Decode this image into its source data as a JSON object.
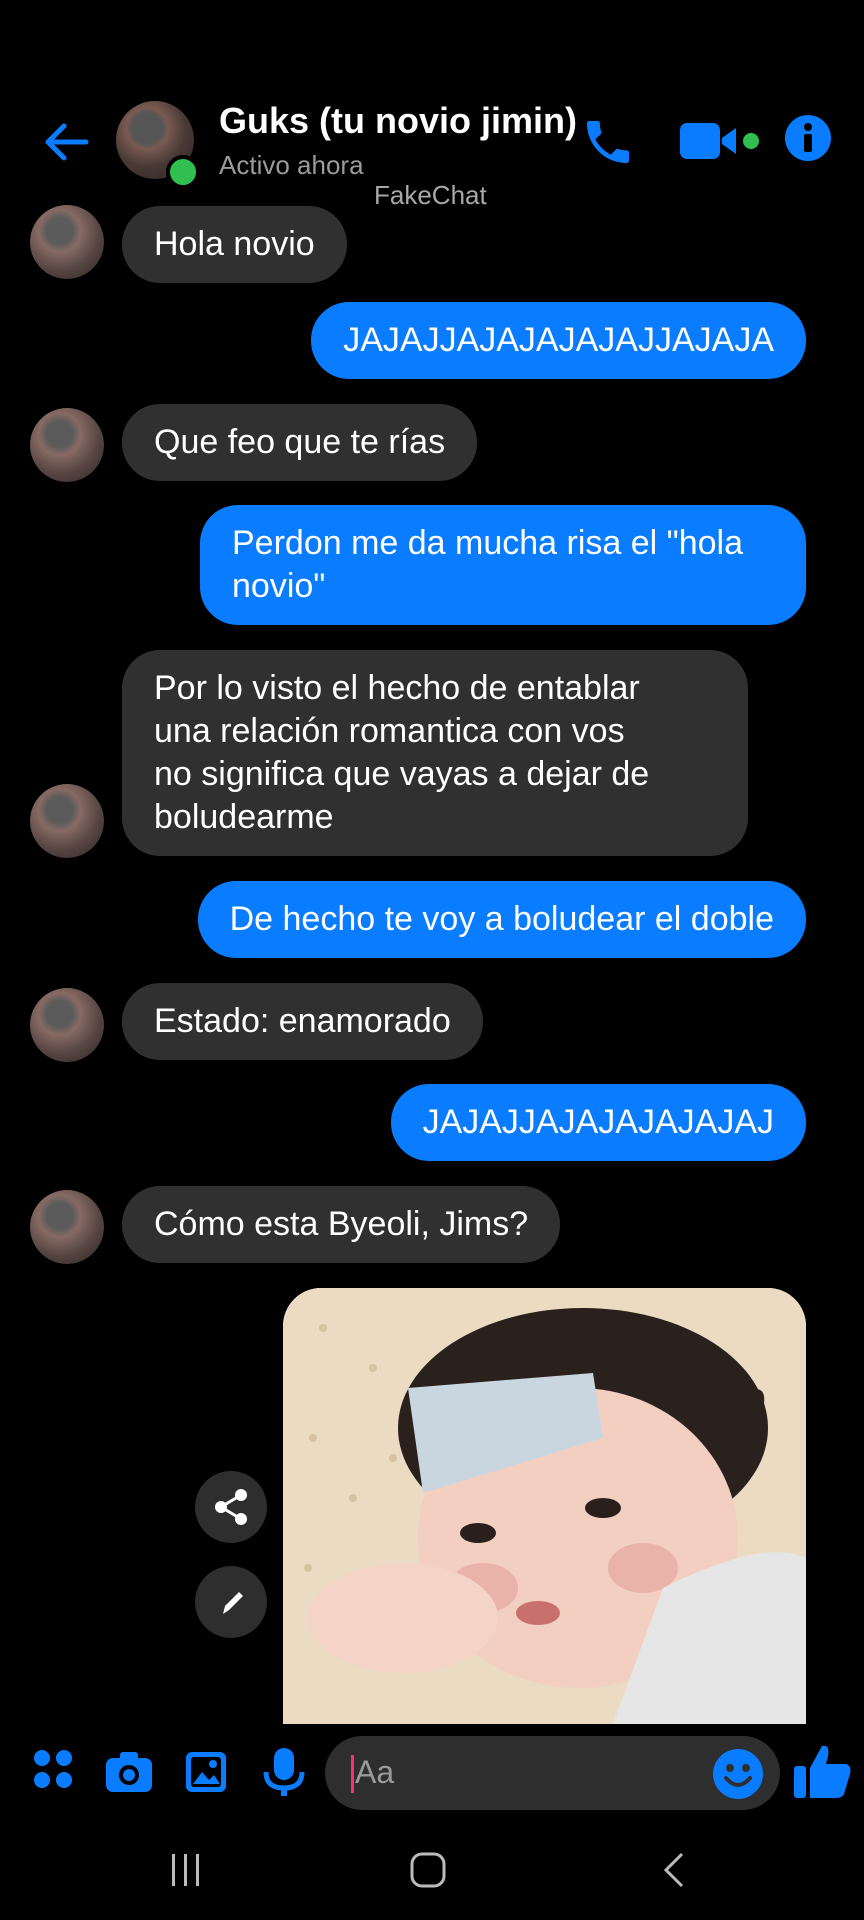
{
  "header": {
    "contact_name": "Guks (tu novio jimin)",
    "status": "Activo ahora",
    "watermark": "FakeChat",
    "icons": [
      "back-arrow-icon",
      "phone-icon",
      "video-camera-icon",
      "info-icon"
    ],
    "accent_color": "#0a7cff",
    "online_color": "#31c04f"
  },
  "messages": [
    {
      "from": "them",
      "text": "Hola novio"
    },
    {
      "from": "me",
      "text": "JAJAJJAJAJAJAJAJJAJAJA"
    },
    {
      "from": "them",
      "text": "Que feo que te rías"
    },
    {
      "from": "me",
      "line1": "Perdon me da mucha risa el \"hola",
      "line2": "novio\""
    },
    {
      "from": "them",
      "line1": "Por lo visto el hecho de entablar",
      "line2": "una relación romantica con vos",
      "line3": "no significa que vayas a dejar de",
      "line4": "boludearme"
    },
    {
      "from": "me",
      "text": "De hecho te voy a boludear el doble"
    },
    {
      "from": "them",
      "text": "Estado: enamorado"
    },
    {
      "from": "me",
      "text": "JAJAJJAJAJAJAJAJAJ"
    },
    {
      "from": "them",
      "text": "Cómo esta Byeoli, Jims?"
    },
    {
      "from": "me",
      "type": "photo"
    }
  ],
  "composer": {
    "placeholder": "Aa",
    "icons": [
      "apps-icon",
      "camera-icon",
      "gallery-icon",
      "microphone-icon",
      "emoji-icon",
      "thumbs-up-icon"
    ]
  },
  "photo_actions": [
    "share-icon",
    "edit-icon"
  ],
  "navbar": [
    "recent-apps-icon",
    "home-icon",
    "back-icon"
  ]
}
